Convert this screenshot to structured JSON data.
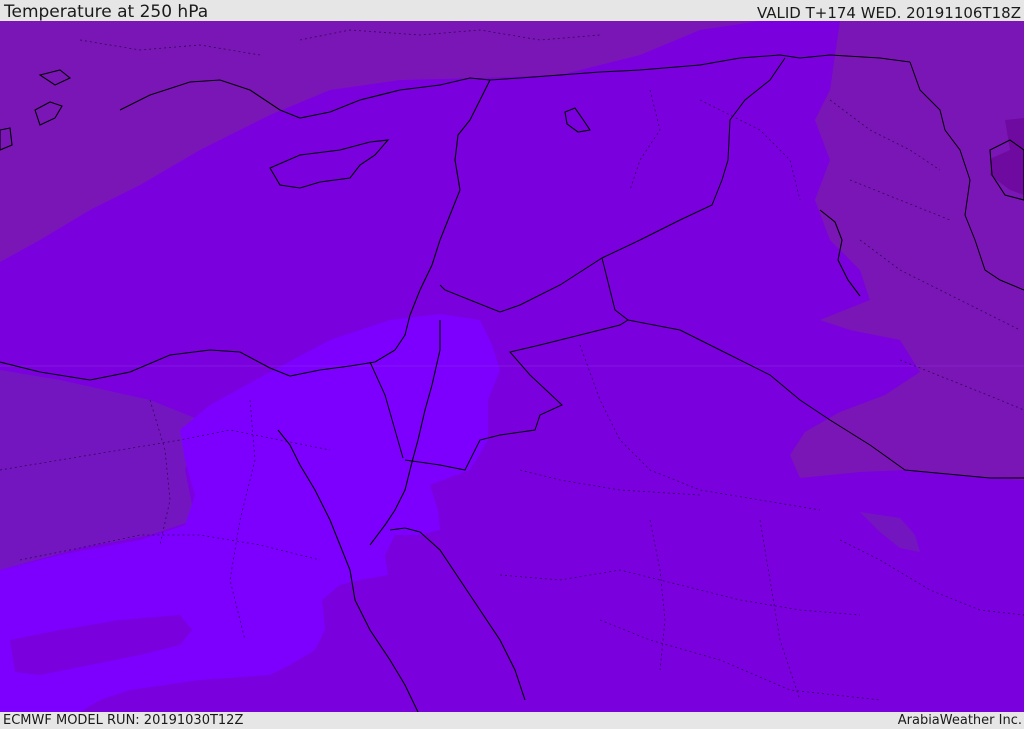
{
  "header": {
    "title": "Temperature at 250 hPa",
    "valid_time": "VALID T+174 WED. 20191106T18Z"
  },
  "footer": {
    "model_run": "ECMWF MODEL RUN: 20191030T12Z",
    "credit": "ArabiaWeather Inc."
  },
  "map": {
    "field": "temperature",
    "level": "250 hPa",
    "colors": {
      "darker_purple": "#7b16b6",
      "mid_purple": "#7a00dd",
      "light_purple": "#7d00ff",
      "darkest_patch": "#6f0aa0",
      "border_line": "#000000"
    }
  }
}
